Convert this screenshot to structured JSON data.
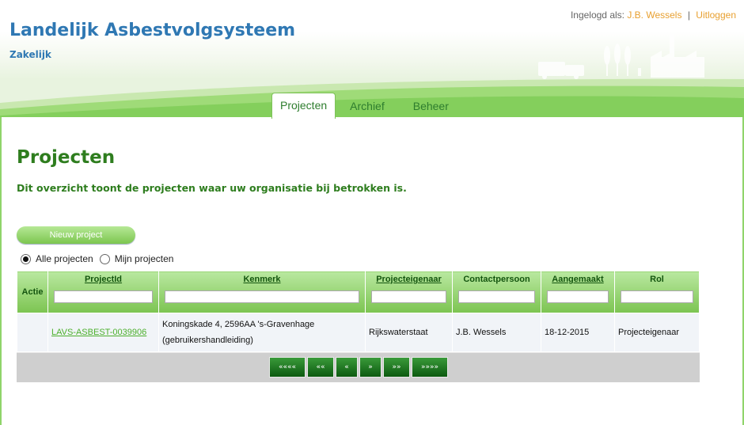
{
  "app": {
    "title": "Landelijk Asbestvolgsysteem",
    "subtitle": "Zakelijk"
  },
  "login": {
    "prefix": "Ingelogd als:",
    "user": "J.B. Wessels",
    "separator": "|",
    "logout": "Uitloggen"
  },
  "tabs": [
    {
      "label": "Projecten"
    },
    {
      "label": "Archief"
    },
    {
      "label": "Beheer"
    }
  ],
  "page": {
    "title": "Projecten",
    "description": "Dit overzicht toont de projecten waar uw organisatie bij betrokken is."
  },
  "new_project_label": "Nieuw project",
  "filters": [
    {
      "label": "Alle projecten",
      "checked": true
    },
    {
      "label": "Mijn projecten",
      "checked": false
    }
  ],
  "table": {
    "headers": [
      "Actie",
      "ProjectId",
      "Kenmerk",
      "Projecteigenaar",
      "Contactpersoon",
      "Aangemaakt",
      "Rol"
    ],
    "rows": [
      {
        "actie": "",
        "project_id": "LAVS-ASBEST-0039906",
        "kenmerk": "Koningskade 4, 2596AA 's-Gravenhage (gebruikershandleiding)",
        "projecteigenaar": "Rijkswaterstaat",
        "contactpersoon": "J.B. Wessels",
        "aangemaakt": "18-12-2015",
        "rol": "Projecteigenaar"
      }
    ]
  },
  "pager": {
    "first": "««««",
    "prev_block": "««",
    "prev": "«",
    "next": "»",
    "next_block": "»»",
    "last": "»»»»"
  },
  "colors": {
    "brand_blue": "#2f78b3",
    "title_green": "#2e7d1e",
    "link_orange": "#e8a030",
    "header_green": "#7cc451"
  }
}
